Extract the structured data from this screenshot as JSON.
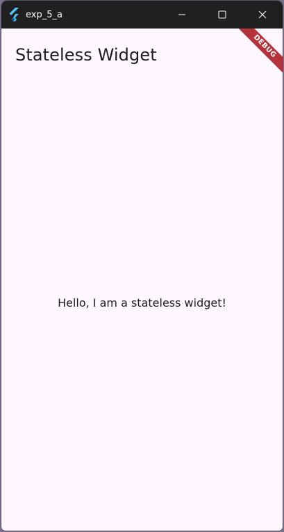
{
  "window": {
    "title": "exp_5_a",
    "icon": "flutter-icon",
    "controls": {
      "minimize_icon": "minimize-icon",
      "maximize_icon": "maximize-icon",
      "close_icon": "close-icon"
    }
  },
  "appbar": {
    "title": "Stateless Widget"
  },
  "body": {
    "text": "Hello, I am a stateless widget!"
  },
  "debug_banner": {
    "label": "DEBUG"
  },
  "colors": {
    "titlebar": "#202020",
    "background": "#fef7ff",
    "text": "#1d1b20",
    "debug_banner": "#b6323a"
  }
}
